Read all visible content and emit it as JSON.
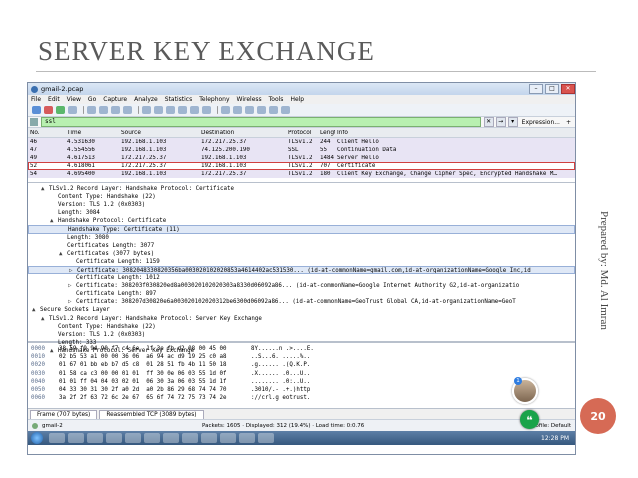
{
  "slide": {
    "title": "SERVER KEY EXCHANGE",
    "side_text": "Prepared by: Md. Al Imran",
    "slide_number": "20"
  },
  "window": {
    "title": "gmail-2.pcap",
    "menu": [
      "File",
      "Edit",
      "View",
      "Go",
      "Capture",
      "Analyze",
      "Statistics",
      "Telephony",
      "Wireless",
      "Tools",
      "Help"
    ],
    "filter_value": "ssl",
    "expression_label": "Expression...",
    "plus_label": "+"
  },
  "packet_list": {
    "columns": [
      "No.",
      "Time",
      "Source",
      "Destination",
      "Protocol",
      "Length",
      "Info"
    ],
    "rows": [
      [
        "46",
        "4.531630",
        "192.168.1.103",
        "172.217.25.37",
        "TLSv1.2",
        "244",
        "Client Hello"
      ],
      [
        "47",
        "4.554556",
        "192.168.1.103",
        "74.125.200.190",
        "SSL",
        "55",
        "Continuation Data"
      ],
      [
        "49",
        "4.617513",
        "172.217.25.37",
        "192.168.1.103",
        "TLSv1.2",
        "1484",
        "Server Hello"
      ],
      [
        "52",
        "4.618061",
        "172.217.25.37",
        "192.168.1.103",
        "TLSv1.2",
        "707",
        "Certificate"
      ],
      [
        "54",
        "4.695400",
        "192.168.1.103",
        "172.217.25.37",
        "TLSv1.2",
        "180",
        "Client Key Exchange, Change Cipher Spec, Encrypted Handshake M…"
      ]
    ],
    "selected_index": 3
  },
  "details": [
    {
      "indent": 1,
      "tri": "▲",
      "text": "TLSv1.2 Record Layer: Handshake Protocol: Certificate"
    },
    {
      "indent": 2,
      "tri": "",
      "text": "Content Type: Handshake (22)"
    },
    {
      "indent": 2,
      "tri": "",
      "text": "Version: TLS 1.2 (0x0303)"
    },
    {
      "indent": 2,
      "tri": "",
      "text": "Length: 3084"
    },
    {
      "indent": 2,
      "tri": "▲",
      "text": "Handshake Protocol: Certificate"
    },
    {
      "indent": 3,
      "tri": "",
      "text": "Handshake Type: Certificate (11)",
      "hl": true
    },
    {
      "indent": 3,
      "tri": "",
      "text": "Length: 3080"
    },
    {
      "indent": 3,
      "tri": "",
      "text": "Certificates Length: 3077"
    },
    {
      "indent": 3,
      "tri": "▲",
      "text": "Certificates (3077 bytes)"
    },
    {
      "indent": 4,
      "tri": "",
      "text": "Certificate Length: 1159"
    },
    {
      "indent": 4,
      "tri": "▷",
      "text": "Certificate: 3082048330820356ba003020102020853a4614402ac531530... (id-at-commonName=gmail.com,id-at-organizationName=Google Inc,id",
      "hl": true
    },
    {
      "indent": 4,
      "tri": "",
      "text": "Certificate Length: 1012"
    },
    {
      "indent": 4,
      "tri": "▷",
      "text": "Certificate: 308203f030820ed8a003020102020303a8330d06092a86... (id-at-commonName=Google Internet Authority G2,id-at-organizatio"
    },
    {
      "indent": 4,
      "tri": "",
      "text": "Certificate Length: 897"
    },
    {
      "indent": 4,
      "tri": "▷",
      "text": "Certificate: 308207d30820e6a003020102020312be6300d06092a86... (id-at-commonName=GeoTrust Global CA,id-at-organizationName=GeoT"
    },
    {
      "indent": 0,
      "tri": "▲",
      "text": "Secure Sockets Layer"
    },
    {
      "indent": 1,
      "tri": "▲",
      "text": "TLSv1.2 Record Layer: Handshake Protocol: Server Key Exchange"
    },
    {
      "indent": 2,
      "tri": "",
      "text": "Content Type: Handshake (22)"
    },
    {
      "indent": 2,
      "tri": "",
      "text": "Version: TLS 1.2 (0x0303)"
    },
    {
      "indent": 2,
      "tri": "",
      "text": "Length: 333"
    },
    {
      "indent": 2,
      "tri": "▲",
      "text": "Handshake Protocol: Server Key Exchange"
    }
  ],
  "hex": [
    [
      "0000",
      "38 59 f9 94 90 f7 c4 6e  1f 3e fb d2 08 00 45 00",
      "8Y......n .>....E."
    ],
    [
      "0010",
      "02 b5 53 a1 00 00 36 06  a6 94 ac d9 19 25 c0 a8",
      "..S...6. .....%.."
    ],
    [
      "0020",
      "01 67 01 bb eb b7 d5 c8  01 28 51 fb 4b 11 50 18",
      ".g...... .(Q.K.P."
    ],
    [
      "0030",
      "01 58 ca c3 00 00 01 01  ff 30 0e 06 03 55 1d 0f",
      ".X...... .0...U.."
    ],
    [
      "0040",
      "01 01 ff 04 04 03 02 01  06 30 3a 06 03 55 1d 1f",
      "........ .0:..U.."
    ],
    [
      "0050",
      "04 33 30 31 30 2f a0 2d  a0 2b 86 29 68 74 74 70",
      ".3010/.- .+.)http"
    ],
    [
      "0060",
      "3a 2f 2f 63 72 6c 2e 67  65 6f 74 72 75 73 74 2e",
      "://crl.g eotrust."
    ]
  ],
  "tabs": [
    "Frame (707 bytes)",
    "Reassembled TCP (3089 bytes)"
  ],
  "status": {
    "file": "gmail-2",
    "packets": "Packets: 1605 · Displayed: 312 (19.4%) · Load time: 0:0.76",
    "profile": "Profile: Default"
  },
  "taskbar": {
    "clock": "12:28 PM"
  },
  "chat": {
    "badge": "1",
    "button_glyph": "❝"
  }
}
